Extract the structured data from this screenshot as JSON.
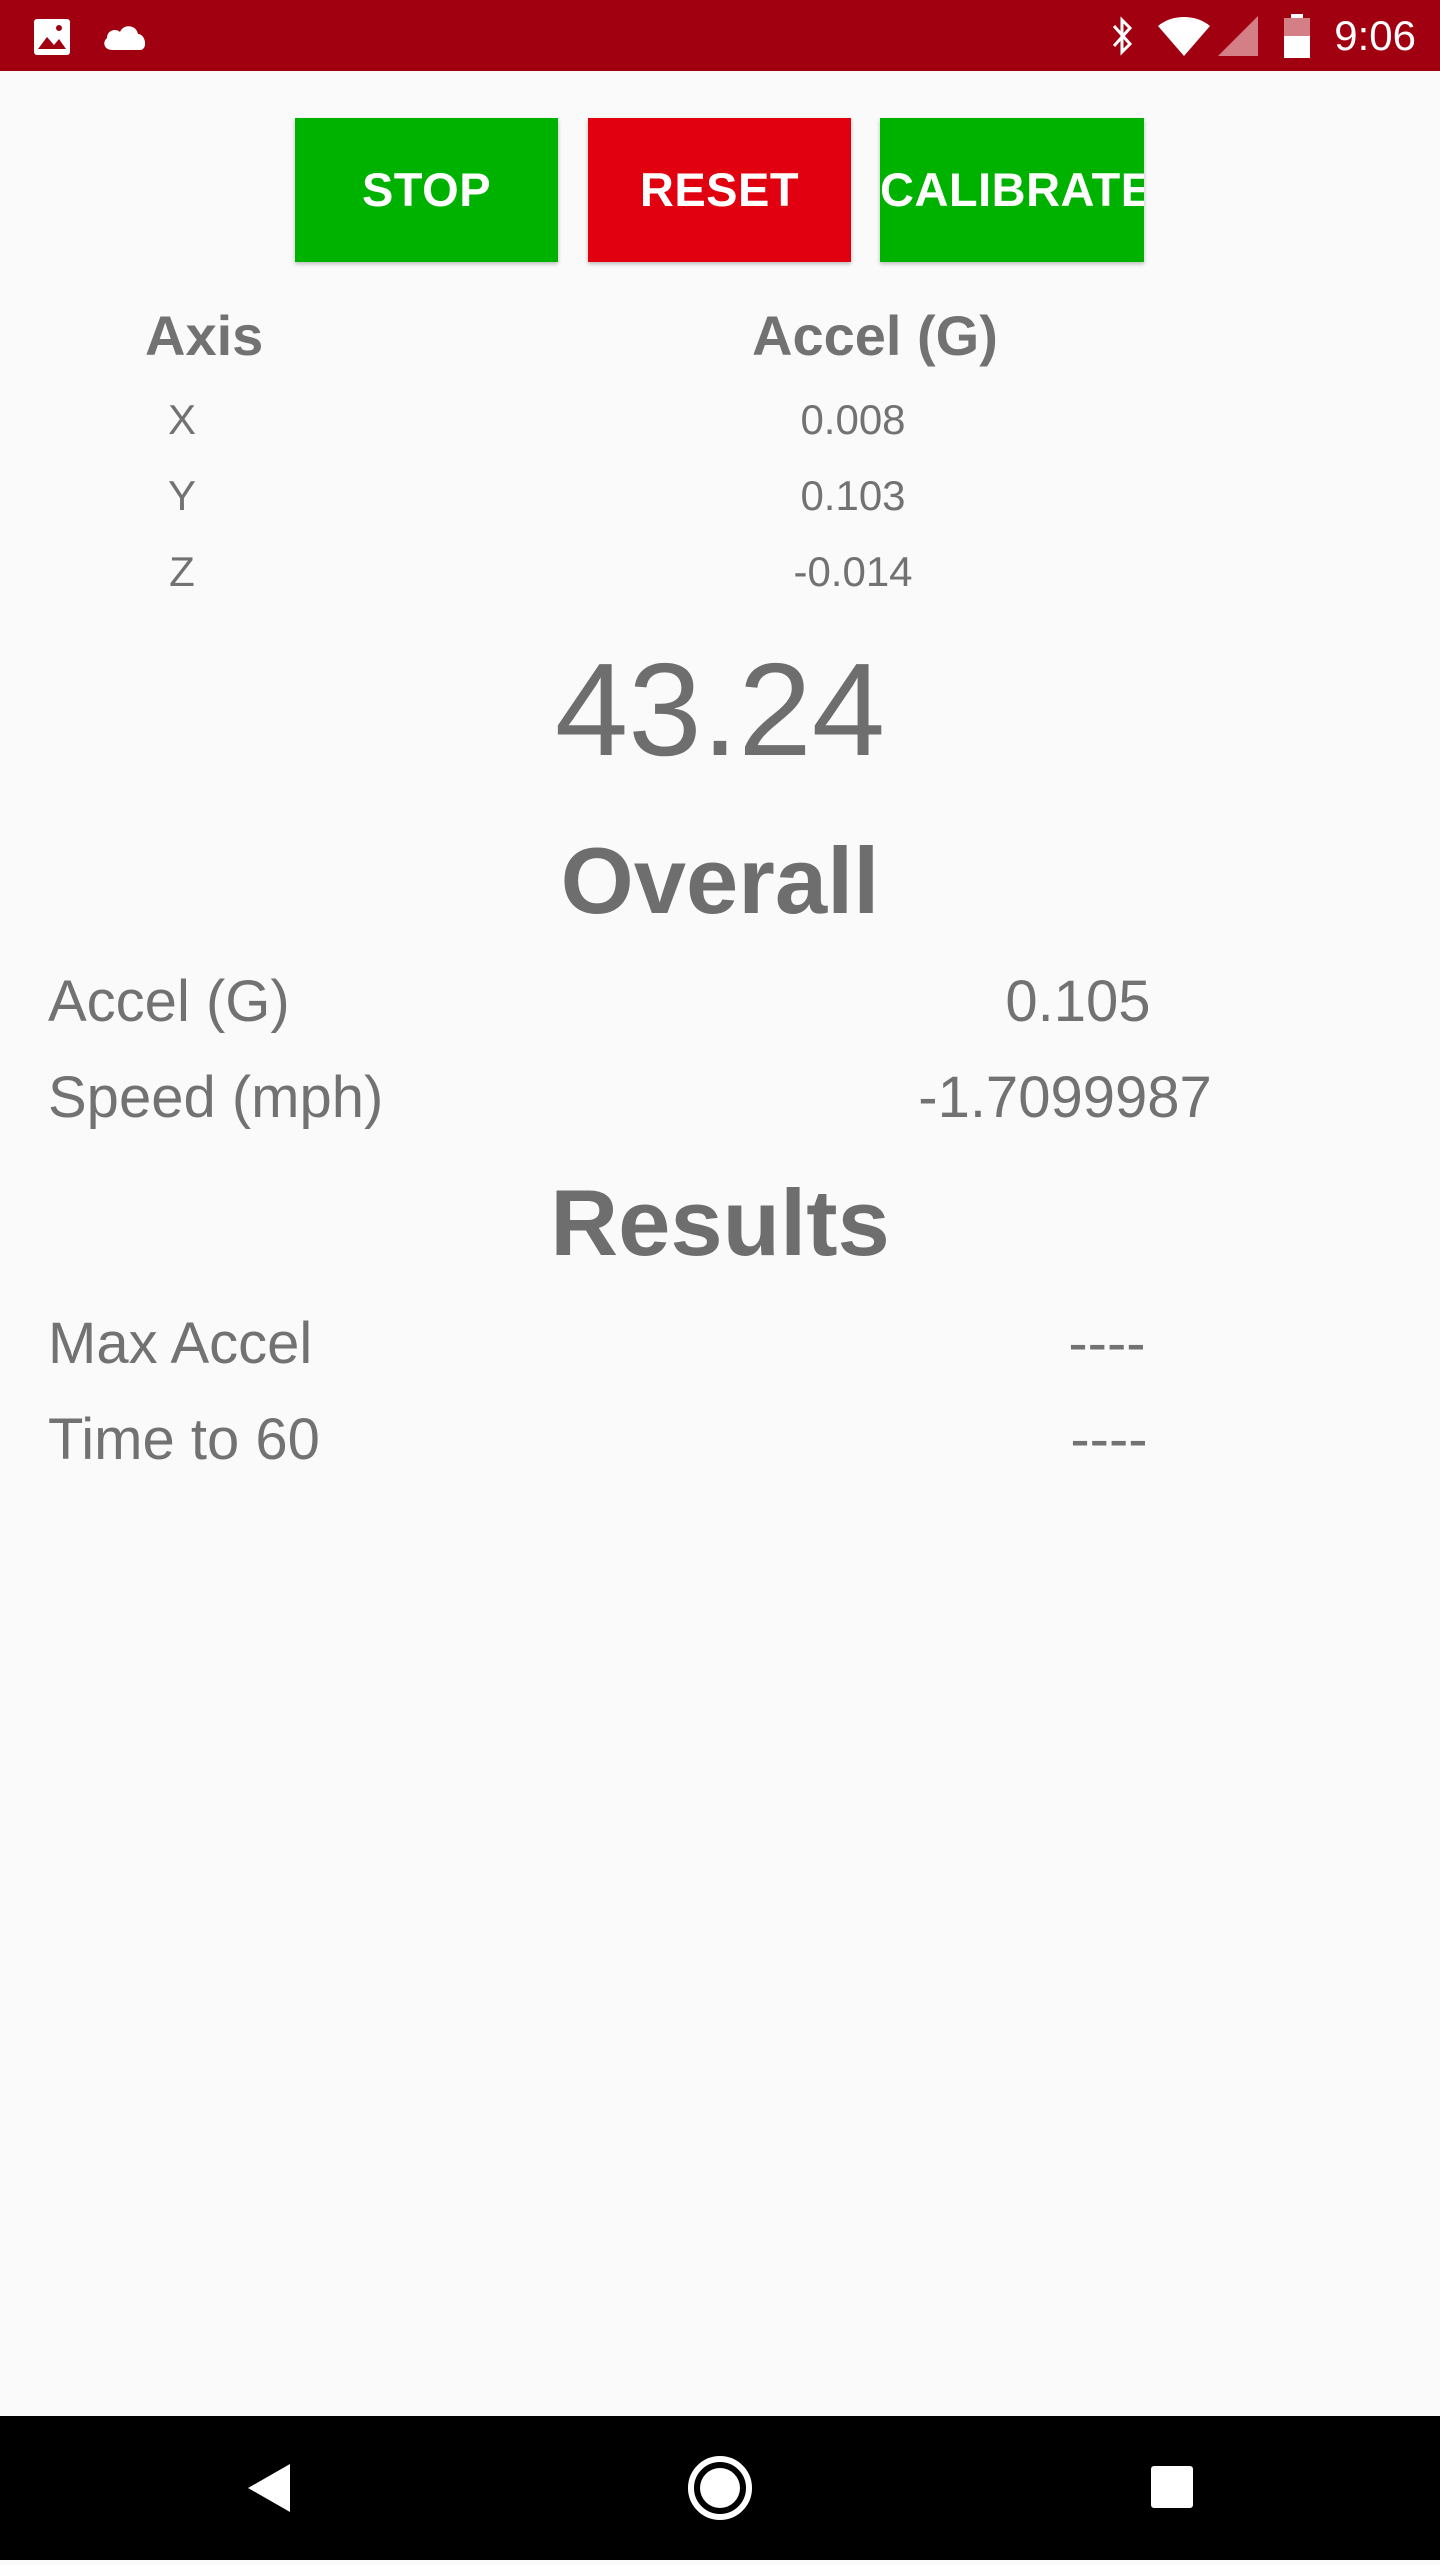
{
  "status_bar": {
    "time": "9:06",
    "background": "#a0000f",
    "icons": [
      "image-icon",
      "cloud-icon",
      "bluetooth-icon",
      "wifi-icon",
      "signal-icon",
      "battery-icon"
    ]
  },
  "buttons": {
    "stop": {
      "label": "STOP",
      "color": "#00b200"
    },
    "reset": {
      "label": "RESET",
      "color": "#e0000f"
    },
    "calibrate": {
      "label": "CALIBRATE",
      "color": "#00b200"
    }
  },
  "axis_table": {
    "headers": {
      "axis": "Axis",
      "accel": "Accel (G)"
    },
    "rows": [
      {
        "axis": "X",
        "accel": "0.008"
      },
      {
        "axis": "Y",
        "accel": "0.103"
      },
      {
        "axis": "Z",
        "accel": "-0.014"
      }
    ]
  },
  "big_number": "43.24",
  "overall": {
    "title": "Overall",
    "rows": [
      {
        "label": "Accel (G)",
        "value": "0.105"
      },
      {
        "label": "Speed (mph)",
        "value": "-1.7099987"
      }
    ]
  },
  "results": {
    "title": "Results",
    "rows": [
      {
        "label": "Max Accel",
        "value": "----"
      },
      {
        "label": "Time to 60",
        "value": "----"
      }
    ]
  },
  "nav_bar": {
    "icons": [
      "back-icon",
      "home-icon",
      "recents-icon"
    ]
  }
}
